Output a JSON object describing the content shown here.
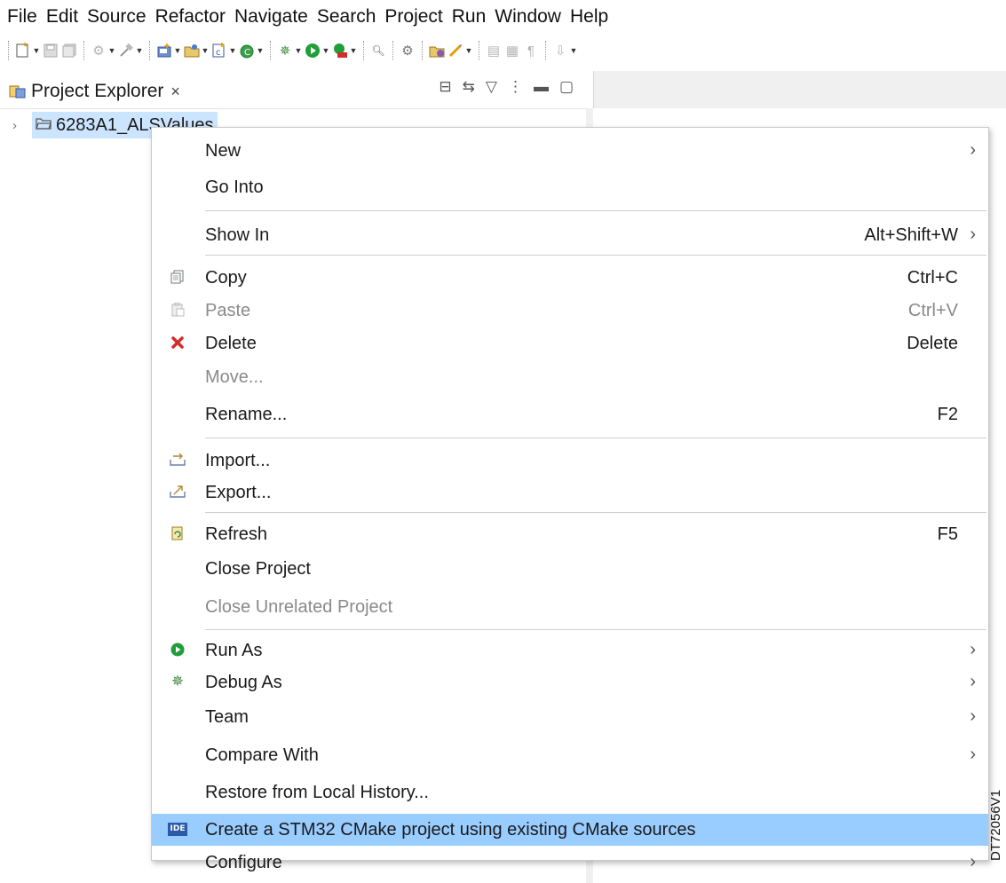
{
  "menubar": [
    "File",
    "Edit",
    "Source",
    "Refactor",
    "Navigate",
    "Search",
    "Project",
    "Run",
    "Window",
    "Help"
  ],
  "view": {
    "tab_label": "Project Explorer",
    "close_glyph": "×"
  },
  "tree": {
    "project_name": "6283A1_ALSValues"
  },
  "context_menu": {
    "new": "New",
    "go_into": "Go Into",
    "show_in": "Show In",
    "show_in_shortcut": "Alt+Shift+W",
    "copy": "Copy",
    "copy_shortcut": "Ctrl+C",
    "paste": "Paste",
    "paste_shortcut": "Ctrl+V",
    "delete": "Delete",
    "delete_shortcut": "Delete",
    "move": "Move...",
    "rename": "Rename...",
    "rename_shortcut": "F2",
    "import": "Import...",
    "export": "Export...",
    "refresh": "Refresh",
    "refresh_shortcut": "F5",
    "close_project": "Close Project",
    "close_unrelated": "Close Unrelated Project",
    "run_as": "Run As",
    "debug_as": "Debug As",
    "team": "Team",
    "compare_with": "Compare With",
    "restore_history": "Restore from Local History...",
    "create_cmake": "Create a STM32 CMake project using existing CMake sources",
    "ide_badge": "IDE",
    "configure": "Configure"
  },
  "icons": {
    "copy": "copy-icon",
    "paste": "paste-icon",
    "delete": "delete-icon",
    "import": "import-icon",
    "export": "export-icon",
    "refresh": "refresh-icon",
    "run": "run-icon",
    "debug": "debug-icon"
  },
  "colors": {
    "highlight": "#99ccff",
    "selection": "#cce5ff",
    "delete_red": "#d62b2b",
    "run_green": "#1f9e3a"
  },
  "watermark": "DT72056V1"
}
